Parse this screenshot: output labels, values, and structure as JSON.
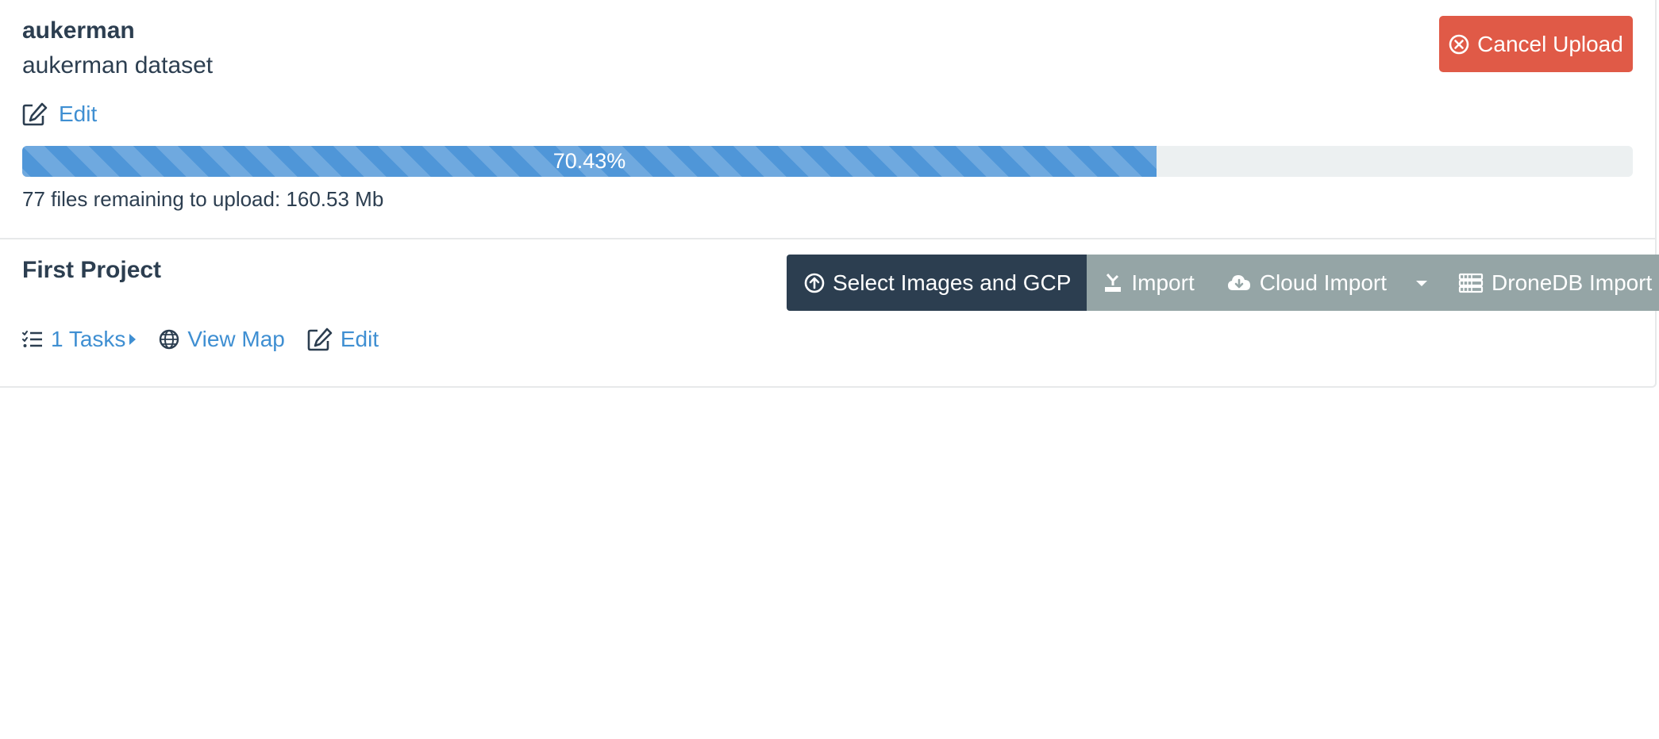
{
  "upload": {
    "title": "aukerman",
    "description": "aukerman dataset",
    "edit_label": "Edit",
    "cancel_label": "Cancel Upload",
    "progress_percent": 70.43,
    "progress_text": "70.43%",
    "remaining_text": "77 files remaining to upload: 160.53 Mb"
  },
  "project": {
    "title": "First Project",
    "buttons": {
      "select_images": "Select Images and GCP",
      "import": "Import",
      "cloud_import": "Cloud Import",
      "dronedb_import": "DroneDB Import"
    },
    "links": {
      "tasks": "1 Tasks",
      "view_map": "View Map",
      "edit": "Edit"
    }
  },
  "colors": {
    "accent_link": "#3f8fd2",
    "cancel_button": "#e05a47",
    "primary_button": "#2c3e50",
    "secondary_button": "#95a5a6",
    "progress_fill": "#4f96d8"
  },
  "icons": {
    "edit": "edit-icon",
    "cancel": "times-circle-icon",
    "upload": "upload-circle-icon",
    "import": "import-icon",
    "cloud": "cloud-download-icon",
    "caret": "caret-down-icon",
    "dronedb": "server-icon",
    "tasks": "tasks-list-icon",
    "globe": "globe-icon"
  }
}
